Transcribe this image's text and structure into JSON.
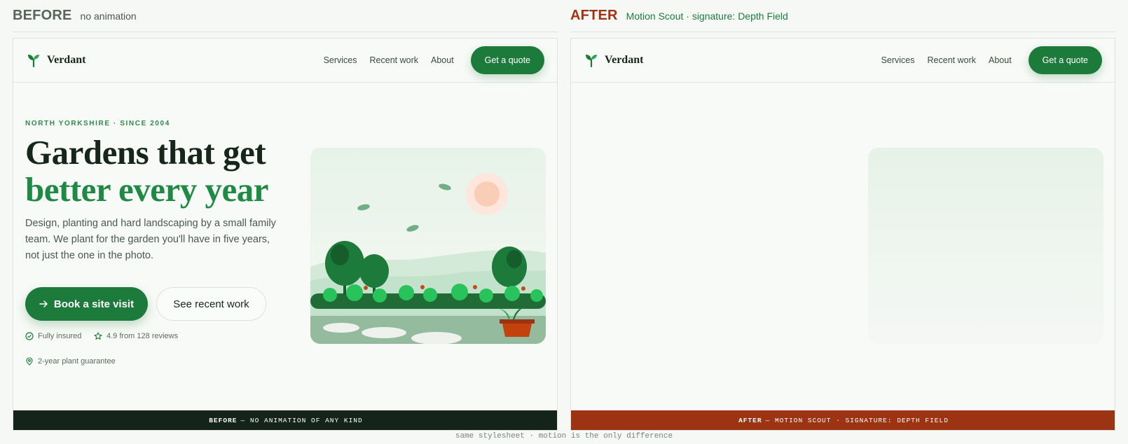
{
  "before": {
    "label": "BEFORE",
    "subtitle": "no animation",
    "footer_label": "BEFORE",
    "footer_text": "— NO ANIMATION OF ANY KIND"
  },
  "after": {
    "label": "AFTER",
    "subtitle": "Motion Scout · signature: Depth Field",
    "footer_label": "AFTER",
    "footer_text": "— MOTION SCOUT · SIGNATURE: DEPTH FIELD"
  },
  "site": {
    "brand": "Verdant",
    "nav": [
      "Services",
      "Recent work",
      "About"
    ],
    "cta": "Get a quote",
    "eyebrow": "NORTH YORKSHIRE · SINCE 2004",
    "headline_line1": "Gardens that get",
    "headline_line2": "better every year",
    "lede": "Design, planting and hard landscaping by a small family team. We plant for the garden you'll have in five years, not just the one in the photo.",
    "primary_button": "Book a site visit",
    "secondary_button": "See recent work",
    "trust": [
      "Fully insured",
      "4.9 from 128 reviews",
      "2-year plant guarantee"
    ]
  },
  "caption": "same stylesheet · motion is the only difference",
  "colors": {
    "brand_green": "#1c7b3a",
    "accent_rust": "#a13313",
    "dark": "#14241a"
  },
  "icons": [
    "sprout-icon",
    "arrow-right-icon",
    "check-circle-icon",
    "star-icon",
    "location-pin-icon"
  ]
}
